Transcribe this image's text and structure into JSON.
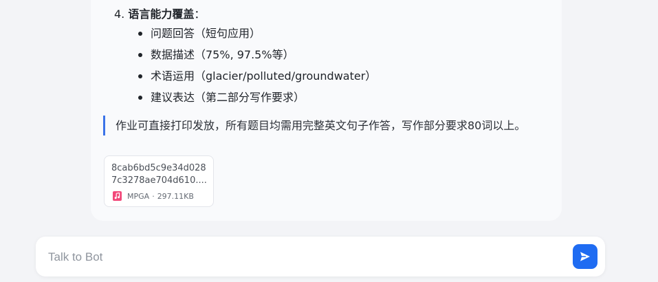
{
  "message": {
    "section": {
      "number": "4.",
      "title": "语言能力覆盖",
      "colon": "："
    },
    "bullets": [
      "问题回答（短句应用）",
      "数据描述（75%, 97.5%等）",
      "术语运用（glacier/polluted/groundwater）",
      "建议表达（第二部分写作要求）"
    ],
    "quote": "作业可直接打印发放，所有题目均需用完整英文句子作答，写作部分要求80词以上。"
  },
  "attachment": {
    "name_line1": "8cab6bd5c9e34d028",
    "name_line2": "7c3278ae704d610....",
    "type": "MPGA",
    "separator": "·",
    "size": "297.11KB",
    "icon": "audio-file-icon"
  },
  "composer": {
    "placeholder": "Talk to Bot",
    "value": "",
    "send_icon": "send-icon"
  },
  "colors": {
    "accent": "#1f6cf2",
    "quote_border": "#3b73e8",
    "audio_icon": "#f2487a"
  }
}
